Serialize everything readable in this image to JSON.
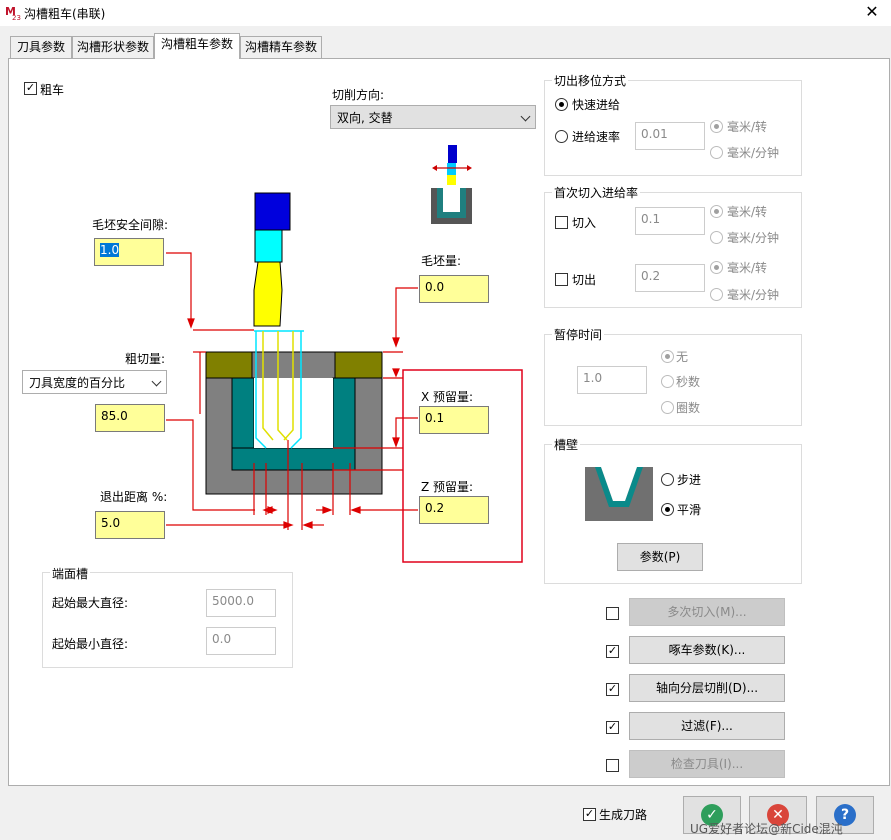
{
  "window": {
    "title": "沟槽粗车(串联)",
    "close": "✕"
  },
  "tabs": [
    "刀具参数",
    "沟槽形状参数",
    "沟槽粗车参数",
    "沟槽精车参数"
  ],
  "rough": {
    "label": "粗车",
    "checked": true
  },
  "cut_direction": {
    "label": "切削方向:",
    "value": "双向, 交替"
  },
  "stock_clearance": {
    "label": "毛坯安全间隙:",
    "value": "1.0"
  },
  "stock_amount": {
    "label": "毛坯量:",
    "value": "0.0"
  },
  "rough_step": {
    "label": "粗切量:",
    "mode": "刀具宽度的百分比",
    "value": "85.0"
  },
  "x_stock": {
    "label": "X 预留量:",
    "value": "0.1"
  },
  "z_stock": {
    "label": "Z 预留量:",
    "value": "0.2"
  },
  "retract": {
    "label": "退出距离 %:",
    "value": "5.0"
  },
  "face_groove": {
    "label": "端面槽",
    "max_dia_label": "起始最大直径:",
    "max_dia": "5000.0",
    "min_dia_label": "起始最小直径:",
    "min_dia": "0.0"
  },
  "retract_move": {
    "label": "切出移位方式",
    "rapid": "快速进给",
    "feed": "进给速率",
    "feed_value": "0.01",
    "unit_rev": "毫米/转",
    "unit_min": "毫米/分钟"
  },
  "first_plunge": {
    "label": "首次切入进给率",
    "in_label": "切入",
    "in_value": "0.1",
    "out_label": "切出",
    "out_value": "0.2",
    "unit_rev": "毫米/转",
    "unit_min": "毫米/分钟"
  },
  "dwell": {
    "label": "暂停时间",
    "value": "1.0",
    "none": "无",
    "seconds": "秒数",
    "revs": "圈数"
  },
  "wall": {
    "label": "槽壁",
    "step": "步进",
    "smooth": "平滑",
    "params_btn": "参数(P)"
  },
  "options": [
    {
      "label": "多次切入(M)...",
      "checked": false,
      "enabled": false
    },
    {
      "label": "啄车参数(K)...",
      "checked": true,
      "enabled": true
    },
    {
      "label": "轴向分层切削(D)...",
      "checked": true,
      "enabled": true
    },
    {
      "label": "过滤(F)...",
      "checked": true,
      "enabled": true
    },
    {
      "label": "检查刀具(I)...",
      "checked": false,
      "enabled": false
    }
  ],
  "generate_path": {
    "label": "生成刀路",
    "checked": true
  },
  "watermark": "UG爱好者论坛@新Cide混沌",
  "colors": {
    "ok": "#2e9e5b",
    "cancel": "#d9453a",
    "help": "#2a6fc9",
    "highlight": "#ffff99",
    "red_box": "#e0001a"
  }
}
